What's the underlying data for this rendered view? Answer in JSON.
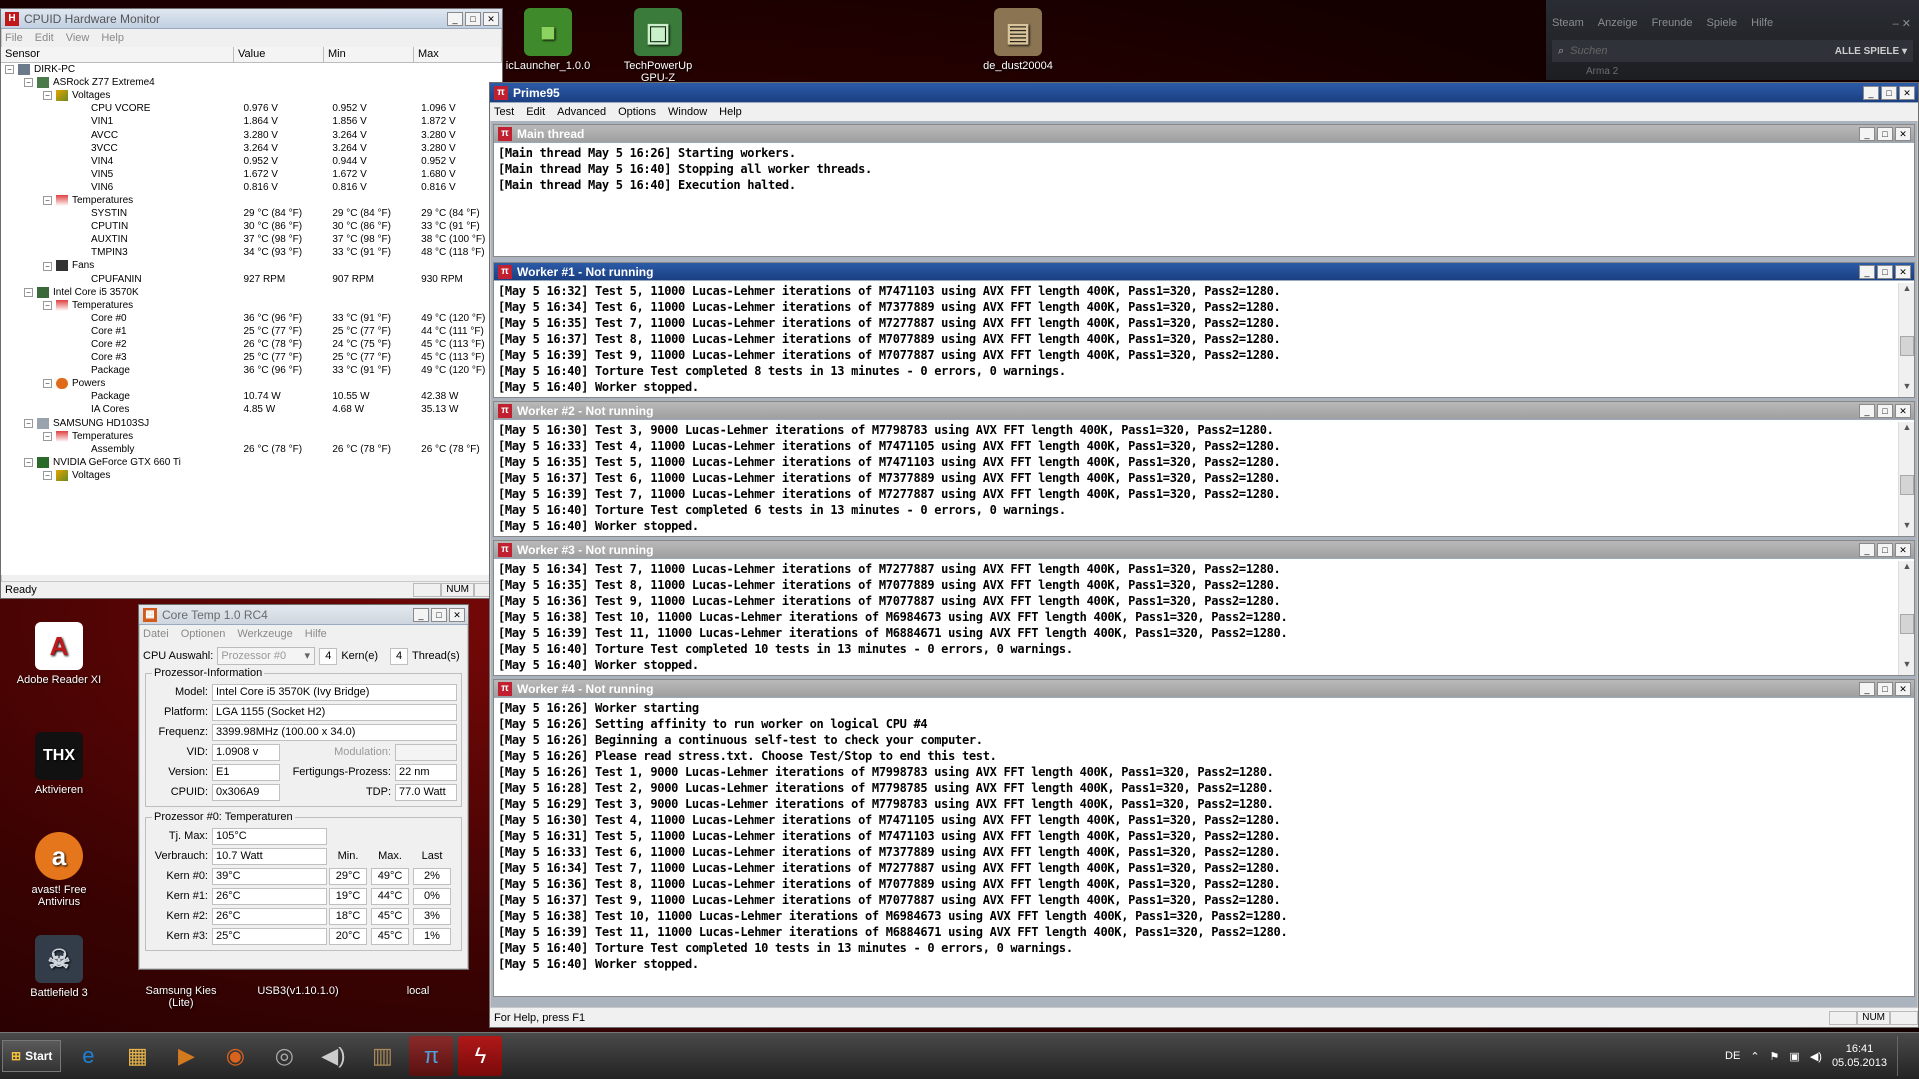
{
  "desktop_icons": [
    {
      "id": "iclauncher",
      "label": "icLauncher_1.0.0",
      "glyph": "■",
      "color": "#3f8a2a"
    },
    {
      "id": "gpuz",
      "label": "TechPowerUp GPU-Z",
      "glyph": "▣",
      "color": "#4a9a4a"
    },
    {
      "id": "dedust",
      "label": "de_dust20004",
      "glyph": "▤",
      "color": "#8a7452"
    },
    {
      "id": "adobe",
      "label": "Adobe Reader XI",
      "glyph": "A",
      "color": "#c0181b"
    },
    {
      "id": "thx",
      "label": "Aktivieren",
      "glyph": "THX",
      "color": "#222"
    },
    {
      "id": "avast",
      "label": "avast! Free Antivirus",
      "glyph": "a",
      "color": "#e6761c"
    },
    {
      "id": "bf3",
      "label": "Battlefield 3",
      "glyph": "☠",
      "color": "#333d4a"
    },
    {
      "id": "kies",
      "label": "Samsung Kies (Lite)",
      "glyph": "",
      "color": "transparent"
    },
    {
      "id": "usb3",
      "label": "USB3(v1.10.1.0)",
      "glyph": "",
      "color": "transparent"
    },
    {
      "id": "local",
      "label": "local",
      "glyph": "",
      "color": "transparent"
    }
  ],
  "hwmon": {
    "title": "CPUID Hardware Monitor",
    "menu": [
      "File",
      "Edit",
      "View",
      "Help"
    ],
    "columns": [
      "Sensor",
      "Value",
      "Min",
      "Max"
    ],
    "status": "Ready",
    "num": "NUM",
    "rows": [
      {
        "indent": 0,
        "exp": "−",
        "icon": "pc",
        "name": "DIRK-PC",
        "v": "",
        "mn": "",
        "mx": ""
      },
      {
        "indent": 1,
        "exp": "−",
        "icon": "board",
        "name": "ASRock Z77 Extreme4",
        "v": "",
        "mn": "",
        "mx": ""
      },
      {
        "indent": 2,
        "exp": "−",
        "icon": "volt",
        "name": "Voltages",
        "v": "",
        "mn": "",
        "mx": ""
      },
      {
        "indent": 3,
        "exp": "",
        "icon": "",
        "name": "CPU VCORE",
        "v": "0.976 V",
        "mn": "0.952 V",
        "mx": "1.096 V"
      },
      {
        "indent": 3,
        "exp": "",
        "icon": "",
        "name": "VIN1",
        "v": "1.864 V",
        "mn": "1.856 V",
        "mx": "1.872 V"
      },
      {
        "indent": 3,
        "exp": "",
        "icon": "",
        "name": "AVCC",
        "v": "3.280 V",
        "mn": "3.264 V",
        "mx": "3.280 V"
      },
      {
        "indent": 3,
        "exp": "",
        "icon": "",
        "name": "3VCC",
        "v": "3.264 V",
        "mn": "3.264 V",
        "mx": "3.280 V"
      },
      {
        "indent": 3,
        "exp": "",
        "icon": "",
        "name": "VIN4",
        "v": "0.952 V",
        "mn": "0.944 V",
        "mx": "0.952 V"
      },
      {
        "indent": 3,
        "exp": "",
        "icon": "",
        "name": "VIN5",
        "v": "1.672 V",
        "mn": "1.672 V",
        "mx": "1.680 V"
      },
      {
        "indent": 3,
        "exp": "",
        "icon": "",
        "name": "VIN6",
        "v": "0.816 V",
        "mn": "0.816 V",
        "mx": "0.816 V"
      },
      {
        "indent": 2,
        "exp": "−",
        "icon": "temp",
        "name": "Temperatures",
        "v": "",
        "mn": "",
        "mx": ""
      },
      {
        "indent": 3,
        "exp": "",
        "icon": "",
        "name": "SYSTIN",
        "v": "29 °C  (84 °F)",
        "mn": "29 °C  (84 °F)",
        "mx": "29 °C  (84 °F)"
      },
      {
        "indent": 3,
        "exp": "",
        "icon": "",
        "name": "CPUTIN",
        "v": "30 °C  (86 °F)",
        "mn": "30 °C  (86 °F)",
        "mx": "33 °C  (91 °F)"
      },
      {
        "indent": 3,
        "exp": "",
        "icon": "",
        "name": "AUXTIN",
        "v": "37 °C  (98 °F)",
        "mn": "37 °C  (98 °F)",
        "mx": "38 °C  (100 °F)"
      },
      {
        "indent": 3,
        "exp": "",
        "icon": "",
        "name": "TMPIN3",
        "v": "34 °C  (93 °F)",
        "mn": "33 °C  (91 °F)",
        "mx": "48 °C  (118 °F)"
      },
      {
        "indent": 2,
        "exp": "−",
        "icon": "fan",
        "name": "Fans",
        "v": "",
        "mn": "",
        "mx": ""
      },
      {
        "indent": 3,
        "exp": "",
        "icon": "",
        "name": "CPUFANIN",
        "v": "927 RPM",
        "mn": "907 RPM",
        "mx": "930 RPM"
      },
      {
        "indent": 1,
        "exp": "−",
        "icon": "chip",
        "name": "Intel Core i5 3570K",
        "v": "",
        "mn": "",
        "mx": ""
      },
      {
        "indent": 2,
        "exp": "−",
        "icon": "temp",
        "name": "Temperatures",
        "v": "",
        "mn": "",
        "mx": ""
      },
      {
        "indent": 3,
        "exp": "",
        "icon": "",
        "name": "Core #0",
        "v": "36 °C  (96 °F)",
        "mn": "33 °C  (91 °F)",
        "mx": "49 °C  (120 °F)"
      },
      {
        "indent": 3,
        "exp": "",
        "icon": "",
        "name": "Core #1",
        "v": "25 °C  (77 °F)",
        "mn": "25 °C  (77 °F)",
        "mx": "44 °C  (111 °F)"
      },
      {
        "indent": 3,
        "exp": "",
        "icon": "",
        "name": "Core #2",
        "v": "26 °C  (78 °F)",
        "mn": "24 °C  (75 °F)",
        "mx": "45 °C  (113 °F)"
      },
      {
        "indent": 3,
        "exp": "",
        "icon": "",
        "name": "Core #3",
        "v": "25 °C  (77 °F)",
        "mn": "25 °C  (77 °F)",
        "mx": "45 °C  (113 °F)"
      },
      {
        "indent": 3,
        "exp": "",
        "icon": "",
        "name": "Package",
        "v": "36 °C  (96 °F)",
        "mn": "33 °C  (91 °F)",
        "mx": "49 °C  (120 °F)"
      },
      {
        "indent": 2,
        "exp": "−",
        "icon": "power",
        "name": "Powers",
        "v": "",
        "mn": "",
        "mx": ""
      },
      {
        "indent": 3,
        "exp": "",
        "icon": "",
        "name": "Package",
        "v": "10.74 W",
        "mn": "10.55 W",
        "mx": "42.38 W"
      },
      {
        "indent": 3,
        "exp": "",
        "icon": "",
        "name": "IA Cores",
        "v": "4.85 W",
        "mn": "4.68 W",
        "mx": "35.13 W"
      },
      {
        "indent": 1,
        "exp": "−",
        "icon": "hdd",
        "name": "SAMSUNG HD103SJ",
        "v": "",
        "mn": "",
        "mx": ""
      },
      {
        "indent": 2,
        "exp": "−",
        "icon": "temp",
        "name": "Temperatures",
        "v": "",
        "mn": "",
        "mx": ""
      },
      {
        "indent": 3,
        "exp": "",
        "icon": "",
        "name": "Assembly",
        "v": "26 °C  (78 °F)",
        "mn": "26 °C  (78 °F)",
        "mx": "26 °C  (78 °F)"
      },
      {
        "indent": 1,
        "exp": "−",
        "icon": "gpu",
        "name": "NVIDIA GeForce GTX 660 Ti",
        "v": "",
        "mn": "",
        "mx": ""
      },
      {
        "indent": 2,
        "exp": "−",
        "icon": "volt",
        "name": "Voltages",
        "v": "",
        "mn": "",
        "mx": ""
      }
    ]
  },
  "coretemp": {
    "title": "Core Temp 1.0 RC4",
    "menu": [
      "Datei",
      "Optionen",
      "Werkzeuge",
      "Hilfe"
    ],
    "cpu_select_label": "CPU Auswahl:",
    "cpu_select_value": "Prozessor #0",
    "cores": "4",
    "cores_label": "Kern(e)",
    "threads": "4",
    "threads_label": "Thread(s)",
    "info_group": "Prozessor-Information",
    "model_label": "Model:",
    "model": "Intel Core i5 3570K (Ivy Bridge)",
    "platform_label": "Platform:",
    "platform": "LGA 1155 (Socket H2)",
    "freq_label": "Frequenz:",
    "freq": "3399.98MHz (100.00 x 34.0)",
    "vid_label": "VID:",
    "vid": "1.0908 v",
    "mod_label": "Modulation:",
    "version_label": "Version:",
    "version": "E1",
    "process_label": "Fertigungs-Prozess:",
    "process": "22 nm",
    "cpuid_label": "CPUID:",
    "cpuid": "0x306A9",
    "tdp_label": "TDP:",
    "tdp": "77.0 Watt",
    "temp_group": "Prozessor #0: Temperaturen",
    "tjmax_label": "Tj. Max:",
    "tjmax": "105°C",
    "power_label": "Verbrauch:",
    "power": "10.7 Watt",
    "col_min": "Min.",
    "col_max": "Max.",
    "col_load": "Last",
    "cores_rows": [
      {
        "label": "Kern #0:",
        "t": "39°C",
        "min": "29°C",
        "max": "49°C",
        "load": "2%"
      },
      {
        "label": "Kern #1:",
        "t": "26°C",
        "min": "19°C",
        "max": "44°C",
        "load": "0%"
      },
      {
        "label": "Kern #2:",
        "t": "26°C",
        "min": "18°C",
        "max": "45°C",
        "load": "3%"
      },
      {
        "label": "Kern #3:",
        "t": "25°C",
        "min": "20°C",
        "max": "45°C",
        "load": "1%"
      }
    ]
  },
  "prime95": {
    "title": "Prime95",
    "menu": [
      "Test",
      "Edit",
      "Advanced",
      "Options",
      "Window",
      "Help"
    ],
    "status": "For Help, press F1",
    "num": "NUM",
    "windows": [
      {
        "id": "main",
        "title": "Main thread",
        "active": false,
        "lines": [
          "[Main thread May 5 16:26] Starting workers.",
          "[Main thread May 5 16:40] Stopping all worker threads.",
          "[Main thread May 5 16:40] Execution halted."
        ]
      },
      {
        "id": "w1",
        "title": "Worker #1 - Not running",
        "active": true,
        "lines": [
          "[May 5 16:32] Test 5, 11000 Lucas-Lehmer iterations of M7471103 using AVX FFT length 400K, Pass1=320, Pass2=1280.",
          "[May 5 16:34] Test 6, 11000 Lucas-Lehmer iterations of M7377889 using AVX FFT length 400K, Pass1=320, Pass2=1280.",
          "[May 5 16:35] Test 7, 11000 Lucas-Lehmer iterations of M7277887 using AVX FFT length 400K, Pass1=320, Pass2=1280.",
          "[May 5 16:37] Test 8, 11000 Lucas-Lehmer iterations of M7077889 using AVX FFT length 400K, Pass1=320, Pass2=1280.",
          "[May 5 16:39] Test 9, 11000 Lucas-Lehmer iterations of M7077887 using AVX FFT length 400K, Pass1=320, Pass2=1280.",
          "[May 5 16:40] Torture Test completed 8 tests in 13 minutes - 0 errors, 0 warnings.",
          "[May 5 16:40] Worker stopped."
        ]
      },
      {
        "id": "w2",
        "title": "Worker #2 - Not running",
        "active": false,
        "lines": [
          "[May 5 16:30] Test 3, 9000 Lucas-Lehmer iterations of M7798783 using AVX FFT length 400K, Pass1=320, Pass2=1280.",
          "[May 5 16:33] Test 4, 11000 Lucas-Lehmer iterations of M7471105 using AVX FFT length 400K, Pass1=320, Pass2=1280.",
          "[May 5 16:35] Test 5, 11000 Lucas-Lehmer iterations of M7471103 using AVX FFT length 400K, Pass1=320, Pass2=1280.",
          "[May 5 16:37] Test 6, 11000 Lucas-Lehmer iterations of M7377889 using AVX FFT length 400K, Pass1=320, Pass2=1280.",
          "[May 5 16:39] Test 7, 11000 Lucas-Lehmer iterations of M7277887 using AVX FFT length 400K, Pass1=320, Pass2=1280.",
          "[May 5 16:40] Torture Test completed 6 tests in 13 minutes - 0 errors, 0 warnings.",
          "[May 5 16:40] Worker stopped."
        ]
      },
      {
        "id": "w3",
        "title": "Worker #3 - Not running",
        "active": false,
        "lines": [
          "[May 5 16:34] Test 7, 11000 Lucas-Lehmer iterations of M7277887 using AVX FFT length 400K, Pass1=320, Pass2=1280.",
          "[May 5 16:35] Test 8, 11000 Lucas-Lehmer iterations of M7077889 using AVX FFT length 400K, Pass1=320, Pass2=1280.",
          "[May 5 16:36] Test 9, 11000 Lucas-Lehmer iterations of M7077887 using AVX FFT length 400K, Pass1=320, Pass2=1280.",
          "[May 5 16:38] Test 10, 11000 Lucas-Lehmer iterations of M6984673 using AVX FFT length 400K, Pass1=320, Pass2=1280.",
          "[May 5 16:39] Test 11, 11000 Lucas-Lehmer iterations of M6884671 using AVX FFT length 400K, Pass1=320, Pass2=1280.",
          "[May 5 16:40] Torture Test completed 10 tests in 13 minutes - 0 errors, 0 warnings.",
          "[May 5 16:40] Worker stopped."
        ]
      },
      {
        "id": "w4",
        "title": "Worker #4 - Not running",
        "active": false,
        "lines": [
          "[May 5 16:26] Worker starting",
          "[May 5 16:26] Setting affinity to run worker on logical CPU #4",
          "[May 5 16:26] Beginning a continuous self-test to check your computer.",
          "[May 5 16:26] Please read stress.txt.  Choose Test/Stop to end this test.",
          "[May 5 16:26] Test 1, 9000 Lucas-Lehmer iterations of M7998783 using AVX FFT length 400K, Pass1=320, Pass2=1280.",
          "[May 5 16:28] Test 2, 9000 Lucas-Lehmer iterations of M7798785 using AVX FFT length 400K, Pass1=320, Pass2=1280.",
          "[May 5 16:29] Test 3, 9000 Lucas-Lehmer iterations of M7798783 using AVX FFT length 400K, Pass1=320, Pass2=1280.",
          "[May 5 16:30] Test 4, 11000 Lucas-Lehmer iterations of M7471105 using AVX FFT length 400K, Pass1=320, Pass2=1280.",
          "[May 5 16:31] Test 5, 11000 Lucas-Lehmer iterations of M7471103 using AVX FFT length 400K, Pass1=320, Pass2=1280.",
          "[May 5 16:33] Test 6, 11000 Lucas-Lehmer iterations of M7377889 using AVX FFT length 400K, Pass1=320, Pass2=1280.",
          "[May 5 16:34] Test 7, 11000 Lucas-Lehmer iterations of M7277887 using AVX FFT length 400K, Pass1=320, Pass2=1280.",
          "[May 5 16:36] Test 8, 11000 Lucas-Lehmer iterations of M7077889 using AVX FFT length 400K, Pass1=320, Pass2=1280.",
          "[May 5 16:37] Test 9, 11000 Lucas-Lehmer iterations of M7077887 using AVX FFT length 400K, Pass1=320, Pass2=1280.",
          "[May 5 16:38] Test 10, 11000 Lucas-Lehmer iterations of M6984673 using AVX FFT length 400K, Pass1=320, Pass2=1280.",
          "[May 5 16:39] Test 11, 11000 Lucas-Lehmer iterations of M6884671 using AVX FFT length 400K, Pass1=320, Pass2=1280.",
          "[May 5 16:40] Torture Test completed 10 tests in 13 minutes - 0 errors, 0 warnings.",
          "[May 5 16:40] Worker stopped."
        ]
      }
    ]
  },
  "steam": {
    "menu": [
      "Steam",
      "Anzeige",
      "Freunde",
      "Spiele",
      "Hilfe"
    ],
    "search_placeholder": "Suchen",
    "filter": "ALLE SPIELE ▾",
    "item": "Arma 2"
  },
  "taskbar": {
    "start": "Start",
    "lang": "DE",
    "time": "16:41",
    "date": "05.05.2013",
    "apps": [
      {
        "id": "ie",
        "glyph": "e",
        "color": "#1e7fd6"
      },
      {
        "id": "explorer",
        "glyph": "▦",
        "color": "#e8b44a"
      },
      {
        "id": "media",
        "glyph": "▶",
        "color": "#d37a1f"
      },
      {
        "id": "firefox",
        "glyph": "◉",
        "color": "#d9621c"
      },
      {
        "id": "steam",
        "glyph": "◎",
        "color": "#aaa"
      },
      {
        "id": "volume",
        "glyph": "◀)",
        "color": "#ccc"
      },
      {
        "id": "hwmonitor",
        "glyph": "▥",
        "color": "#aa8a5a"
      },
      {
        "id": "prime95",
        "glyph": "π",
        "color": "#4aa3df"
      },
      {
        "id": "flash",
        "glyph": "ϟ",
        "color": "#d02020"
      }
    ]
  }
}
